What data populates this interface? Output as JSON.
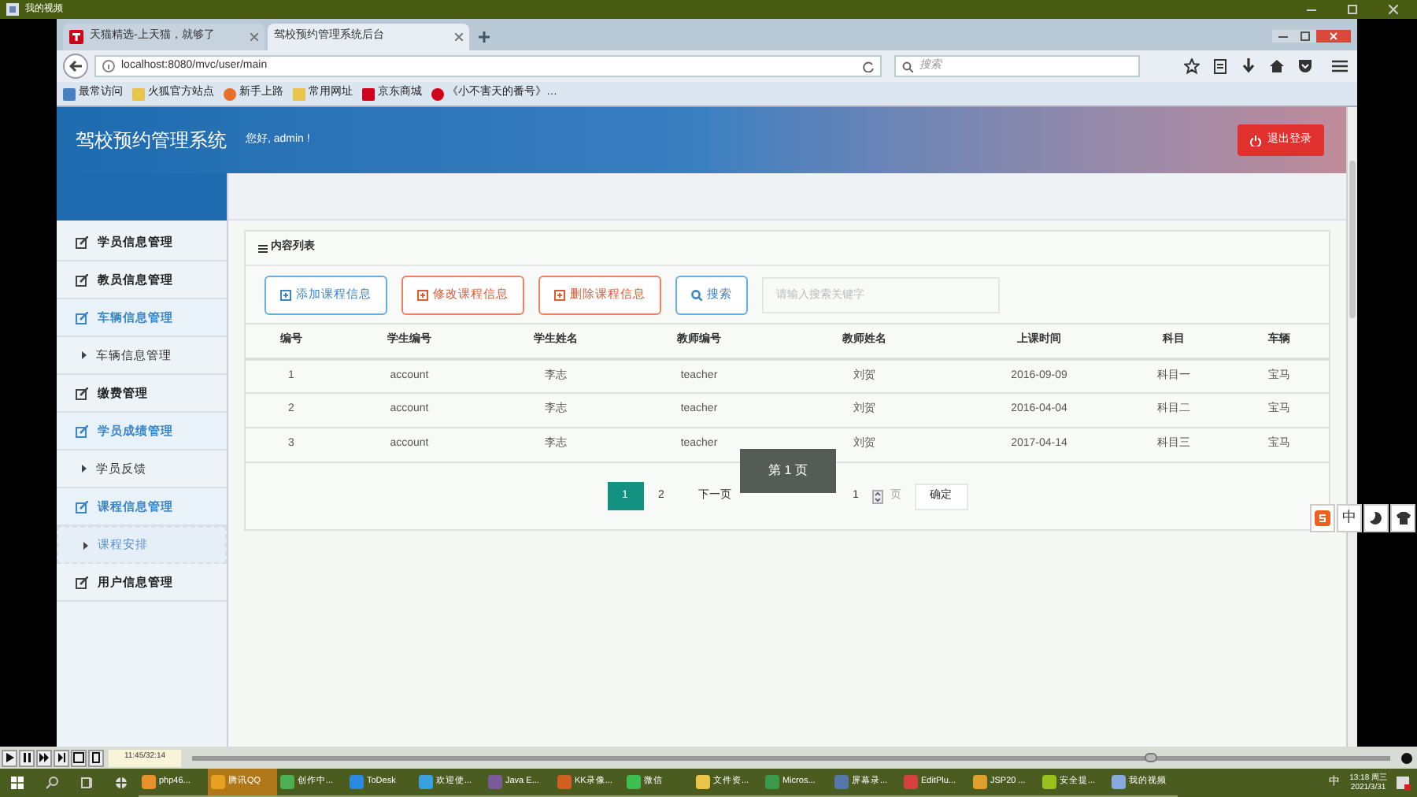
{
  "player_window": {
    "title": "我的视频"
  },
  "browser": {
    "tabs": [
      {
        "label": "天猫精选-上天猫，就够了",
        "selected": false
      },
      {
        "label": "驾校预约管理系统后台",
        "selected": true
      }
    ],
    "url": "localhost:8080/mvc/user/main",
    "search": {
      "placeholder": "搜索"
    },
    "bookmarks": [
      "最常访问",
      "火狐官方站点",
      "新手上路",
      "常用网址",
      "京东商城",
      "《小不害天的番号》…"
    ]
  },
  "app": {
    "title": "驾校预约管理系统",
    "greeting": "您好, admin !",
    "logout": "退出登录",
    "sidebar": [
      {
        "label": "学员信息管理",
        "kind": "group",
        "expanded": false,
        "selected": false
      },
      {
        "label": "教员信息管理",
        "kind": "group",
        "expanded": false,
        "selected": false
      },
      {
        "label": "车辆信息管理",
        "kind": "group",
        "expanded": true,
        "selected": false
      },
      {
        "label": "车辆信息管理",
        "kind": "sub",
        "selected": false
      },
      {
        "label": "缴费管理",
        "kind": "group",
        "expanded": false,
        "selected": false
      },
      {
        "label": "学员成绩管理",
        "kind": "group",
        "expanded": true,
        "selected": false
      },
      {
        "label": "学员反馈",
        "kind": "sub",
        "selected": false
      },
      {
        "label": "课程信息管理",
        "kind": "group",
        "expanded": true,
        "selected": false
      },
      {
        "label": "课程安排",
        "kind": "sub",
        "selected": true
      },
      {
        "label": "用户信息管理",
        "kind": "group",
        "expanded": false,
        "selected": false
      }
    ],
    "panel": {
      "title": "内容列表",
      "buttons": [
        {
          "label": "添加课程信息",
          "kind": "add"
        },
        {
          "label": "修改课程信息",
          "kind": "edit"
        },
        {
          "label": "删除课程信息",
          "kind": "delete"
        },
        {
          "label": "搜索",
          "kind": "search"
        }
      ],
      "search": {
        "placeholder": "请输入搜索关键字"
      },
      "table": {
        "columns": [
          "编号",
          "学生编号",
          "学生姓名",
          "教师编号",
          "教师姓名",
          "上课时间",
          "科目",
          "车辆"
        ],
        "rows": [
          [
            "1",
            "account",
            "李志",
            "teacher",
            "刘贺",
            "2016-09-09",
            "科目一",
            "宝马"
          ],
          [
            "2",
            "account",
            "李志",
            "teacher",
            "刘贺",
            "2016-04-04",
            "科目二",
            "宝马"
          ],
          [
            "3",
            "account",
            "李志",
            "teacher",
            "刘贺",
            "2017-04-14",
            "科目三",
            "宝马"
          ]
        ]
      },
      "pagination": {
        "pages": [
          {
            "label": "1",
            "selected": true
          },
          {
            "label": "2",
            "selected": false
          }
        ],
        "next": "下一页",
        "jump_value": "1",
        "page_unit": "页",
        "confirm": "确定",
        "tooltip": "第 1 页"
      }
    }
  },
  "ime": {
    "mode": "中"
  },
  "player": {
    "time": "11:45/32:14"
  },
  "taskbar": {
    "items": [
      {
        "label": "php46...",
        "selected": false
      },
      {
        "label": "腾讯QQ",
        "selected": true
      },
      {
        "label": "创作中...",
        "selected": false
      },
      {
        "label": "ToDesk",
        "selected": false
      },
      {
        "label": "欢迎使...",
        "selected": false
      },
      {
        "label": "Java E...",
        "selected": false
      },
      {
        "label": "KK录像...",
        "selected": false
      },
      {
        "label": "微信",
        "selected": false
      },
      {
        "label": "文件资...",
        "selected": false
      },
      {
        "label": "Micros...",
        "selected": false
      },
      {
        "label": "屏幕录...",
        "selected": false
      },
      {
        "label": "EditPlu...",
        "selected": false
      },
      {
        "label": "JSP20 ...",
        "selected": false
      },
      {
        "label": "安全提...",
        "selected": false
      },
      {
        "label": "我的视频",
        "selected": false
      }
    ],
    "ime": "中",
    "time": "13:18 周三",
    "date": "2021/3/31"
  }
}
